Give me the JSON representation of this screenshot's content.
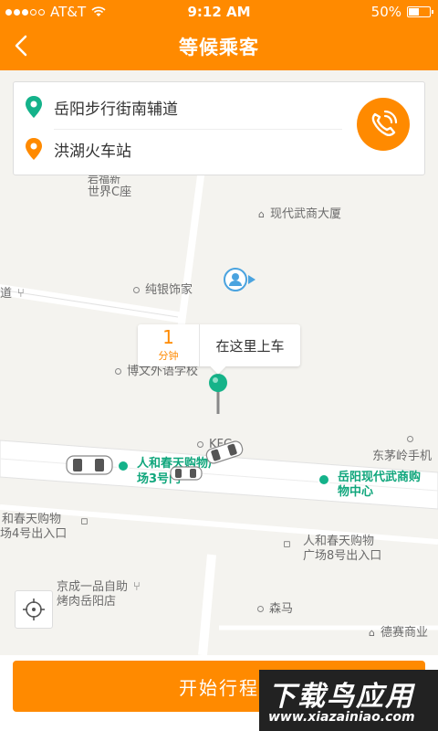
{
  "status_bar": {
    "carrier": "AT&T",
    "time": "9:12 AM",
    "battery": "50%",
    "battery_level": 0.5
  },
  "nav": {
    "title": "等候乘客"
  },
  "addresses": {
    "start": "岳阳步行街南辅道",
    "end": "洪湖火车站"
  },
  "bubble": {
    "minutes": "1",
    "unit": "分钟",
    "text": "在这里上车"
  },
  "map": {
    "pois": {
      "shiji": "世界C座",
      "shijiTop": "岩福新",
      "xiandai": "现代武商大厦",
      "chunyin": "纯银饰家",
      "bowen": "博文外语学校",
      "kfc": "KFC",
      "dongmao": "东茅岭手机",
      "renhe3a": "人和春天购物广",
      "renhe3b": "场3号门",
      "yueyang_a": "岳阳现代武商购",
      "yueyang_b": "物中心",
      "renhe4a": "和春天购物",
      "renhe4b": "场4号出入口",
      "renhe8a": "人和春天购物",
      "renhe8b": "广场8号出入口",
      "jingcheng_a": "京成一品自助",
      "jingcheng_b": "烤肉岳阳店",
      "senma": "森马",
      "desai": "德赛商业",
      "dao": "道"
    }
  },
  "actions": {
    "start_trip": "开始行程"
  },
  "watermark": {
    "title": "下载鸟应用",
    "url": "www.xiazainiao.com"
  },
  "colors": {
    "accent": "#ff8a00",
    "green": "#14b28a"
  }
}
